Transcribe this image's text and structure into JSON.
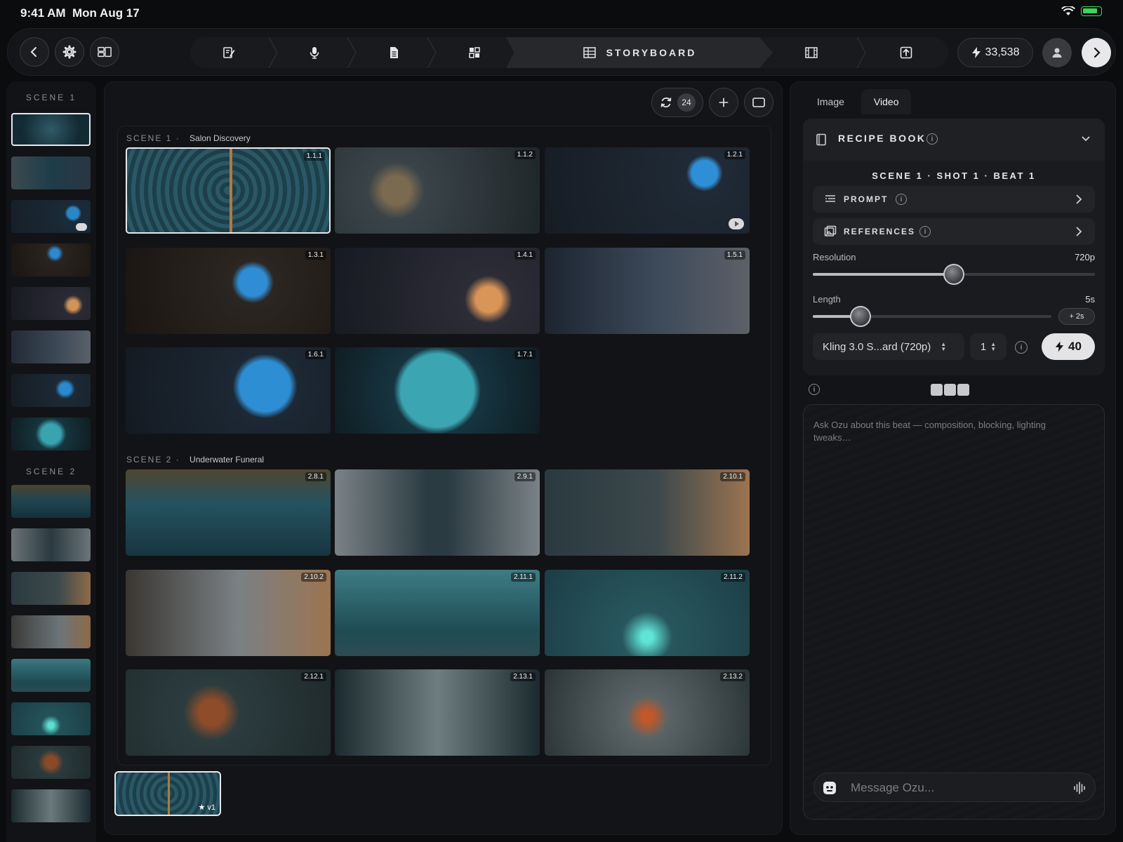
{
  "status": {
    "time": "9:41 AM",
    "date": "Mon Aug 17"
  },
  "toolbar": {
    "active_stage_label": "STORYBOARD",
    "credits": "33,538"
  },
  "left_rail": {
    "scene1_label": "SCENE 1",
    "scene2_label": "SCENE 2"
  },
  "center": {
    "regen_count": "24",
    "scenes": [
      {
        "label": "SCENE 1",
        "name": "Salon Discovery",
        "tiles": [
          "1.1.1",
          "1.1.2",
          "1.2.1",
          "1.3.1",
          "1.4.1",
          "1.5.1",
          "1.6.1",
          "1.7.1"
        ]
      },
      {
        "label": "SCENE 2",
        "name": "Underwater Funeral",
        "tiles": [
          "2.8.1",
          "2.9.1",
          "2.10.1",
          "2.10.2",
          "2.11.1",
          "2.11.2",
          "2.12.1",
          "2.13.1",
          "2.13.2"
        ]
      }
    ],
    "version_label": "v1"
  },
  "right_panel": {
    "tabs": [
      "Image",
      "Video"
    ],
    "active_tab": "Video",
    "recipe_title": "RECIPE BOOK",
    "shot_title": "SCENE 1 · SHOT 1 · BEAT 1",
    "prompt_label": "PROMPT",
    "references_label": "REFERENCES",
    "resolution_label": "Resolution",
    "resolution_value": "720p",
    "resolution_fraction": 0.5,
    "length_label": "Length",
    "length_value": "5s",
    "length_fraction": 0.2,
    "length_add": "+ 2s",
    "model": "Kling 3.0 S...ard (720p)",
    "quantity": "1",
    "cost": "40",
    "chat_placeholder": "Ask Ozu about this beat — composition, blocking, lighting tweaks…",
    "message_placeholder": "Message Ozu..."
  }
}
